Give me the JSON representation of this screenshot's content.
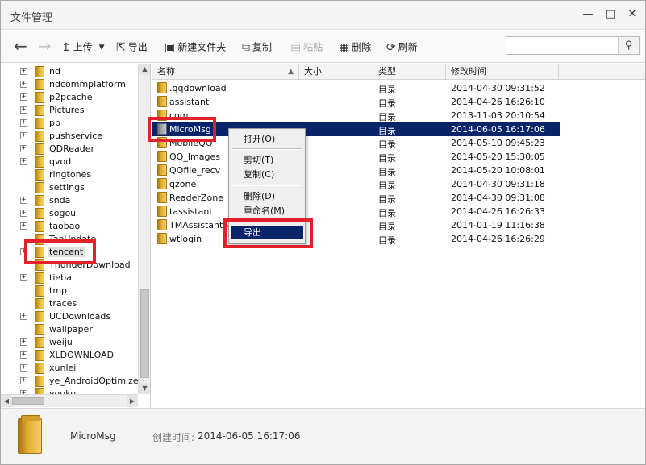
{
  "window": {
    "title": "文件管理",
    "min_icon": "minimize-icon",
    "max_icon": "maximize-icon",
    "close_icon": "close-icon"
  },
  "toolbar": {
    "back_icon": "back-arrow-icon",
    "forward_icon": "forward-arrow-icon",
    "upload_label": "上传",
    "export_label": "导出",
    "new_folder_label": "新建文件夹",
    "copy_label": "复制",
    "paste_label": "粘贴",
    "delete_label": "删除",
    "refresh_label": "刷新"
  },
  "search": {
    "value": "",
    "placeholder": ""
  },
  "tree": {
    "items": [
      {
        "label": "nd",
        "expandable": true
      },
      {
        "label": "ndcommplatform",
        "expandable": true
      },
      {
        "label": "p2pcache",
        "expandable": true
      },
      {
        "label": "Pictures",
        "expandable": true
      },
      {
        "label": "pp",
        "expandable": true
      },
      {
        "label": "pushservice",
        "expandable": true
      },
      {
        "label": "QDReader",
        "expandable": true
      },
      {
        "label": "qvod",
        "expandable": true
      },
      {
        "label": "ringtones",
        "expandable": false
      },
      {
        "label": "settings",
        "expandable": false
      },
      {
        "label": "snda",
        "expandable": true
      },
      {
        "label": "sogou",
        "expandable": true
      },
      {
        "label": "taobao",
        "expandable": true
      },
      {
        "label": "TaoUpdate",
        "expandable": false
      },
      {
        "label": "tencent",
        "expandable": true,
        "selected": true
      },
      {
        "label": "ThunderDownload",
        "expandable": false
      },
      {
        "label": "tieba",
        "expandable": true
      },
      {
        "label": "tmp",
        "expandable": false
      },
      {
        "label": "traces",
        "expandable": false
      },
      {
        "label": "UCDownloads",
        "expandable": true
      },
      {
        "label": "wallpaper",
        "expandable": false
      },
      {
        "label": "weiju",
        "expandable": true
      },
      {
        "label": "XLDOWNLOAD",
        "expandable": true
      },
      {
        "label": "xunlei",
        "expandable": true
      },
      {
        "label": "ye_AndroidOptimizer",
        "expandable": true
      },
      {
        "label": "youku",
        "expandable": true
      }
    ]
  },
  "list": {
    "columns": {
      "name": "名称",
      "size": "大小",
      "type": "类型",
      "modified": "修改时间"
    },
    "rows": [
      {
        "name": ".qqdownload",
        "type": "目录",
        "modified": "2014-04-30 09:31:52"
      },
      {
        "name": "assistant",
        "type": "目录",
        "modified": "2014-04-26 16:26:10"
      },
      {
        "name": "com",
        "type": "目录",
        "modified": "2013-11-03 20:10:54"
      },
      {
        "name": "MicroMsg",
        "type": "目录",
        "modified": "2014-06-05 16:17:06",
        "selected": true
      },
      {
        "name": "MobileQQ",
        "type": "目录",
        "modified": "2014-05-10 09:45:23"
      },
      {
        "name": "QQ_Images",
        "type": "目录",
        "modified": "2014-05-20 15:30:05"
      },
      {
        "name": "QQfile_recv",
        "type": "目录",
        "modified": "2014-05-20 10:08:01"
      },
      {
        "name": "qzone",
        "type": "目录",
        "modified": "2014-04-30 09:31:18"
      },
      {
        "name": "ReaderZone",
        "type": "目录",
        "modified": "2014-04-30 09:31:08"
      },
      {
        "name": "tassistant",
        "type": "目录",
        "modified": "2014-04-26 16:26:33"
      },
      {
        "name": "TMAssistantSDK",
        "type": "目录",
        "modified": "2014-01-19 11:16:38"
      },
      {
        "name": "wtlogin",
        "type": "目录",
        "modified": "2014-04-26 16:26:29"
      }
    ]
  },
  "context_menu": {
    "open": "打开(O)",
    "cut": "剪切(T)",
    "copy": "复制(C)",
    "delete": "删除(D)",
    "rename": "重命名(M)",
    "export": "导出"
  },
  "details": {
    "name": "MicroMsg",
    "created_label": "创建时间:",
    "created_value": "2014-06-05 16:17:06"
  },
  "colors": {
    "selection": "#0a246a",
    "highlight_box": "#e4202a",
    "folder": "#e3b234"
  }
}
